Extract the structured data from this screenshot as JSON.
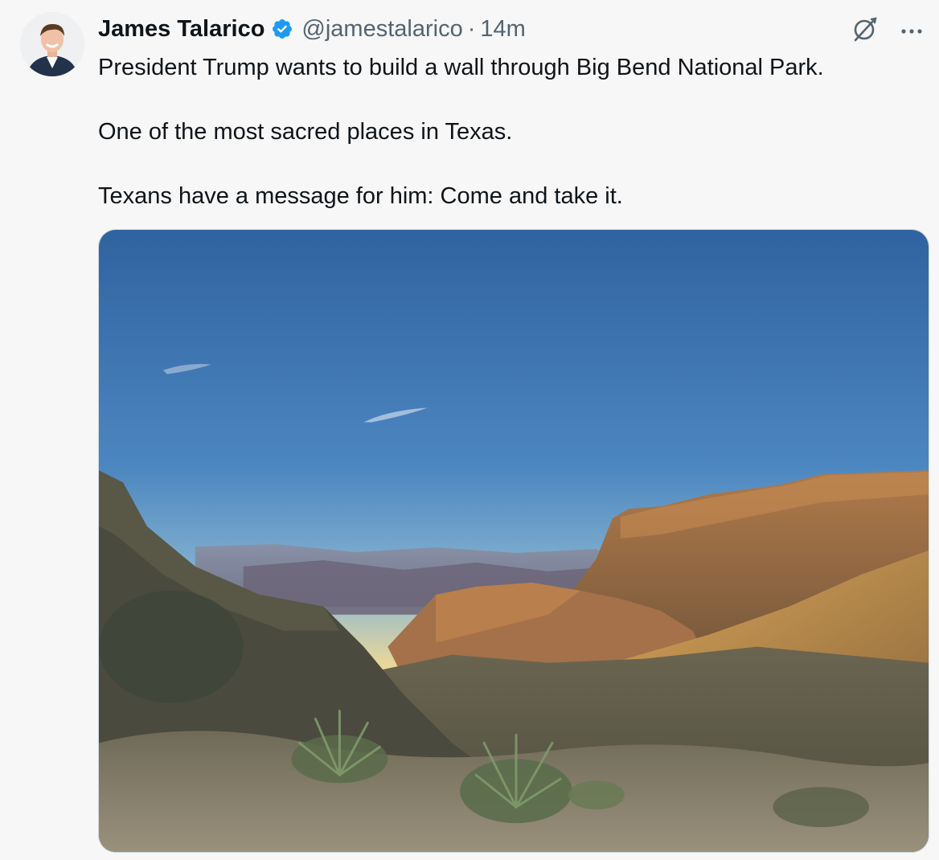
{
  "author": {
    "name": "James Talarico",
    "handle": "@jamestalarico",
    "separator": "·",
    "time": "14m",
    "verified": true
  },
  "icons": {
    "verified": "verified-badge-icon",
    "grok": "grok-icon",
    "more": "more-options-icon"
  },
  "tweet": {
    "lines": [
      "President Trump wants to build a wall through Big Bend National Park.",
      "One of the most sacred places in Texas.",
      "Texans have a message for him: Come and take it."
    ]
  },
  "colors": {
    "verified": "#1d9bf0",
    "text": "#0f1419",
    "secondary": "#536471",
    "background": "#f7f7f7"
  }
}
